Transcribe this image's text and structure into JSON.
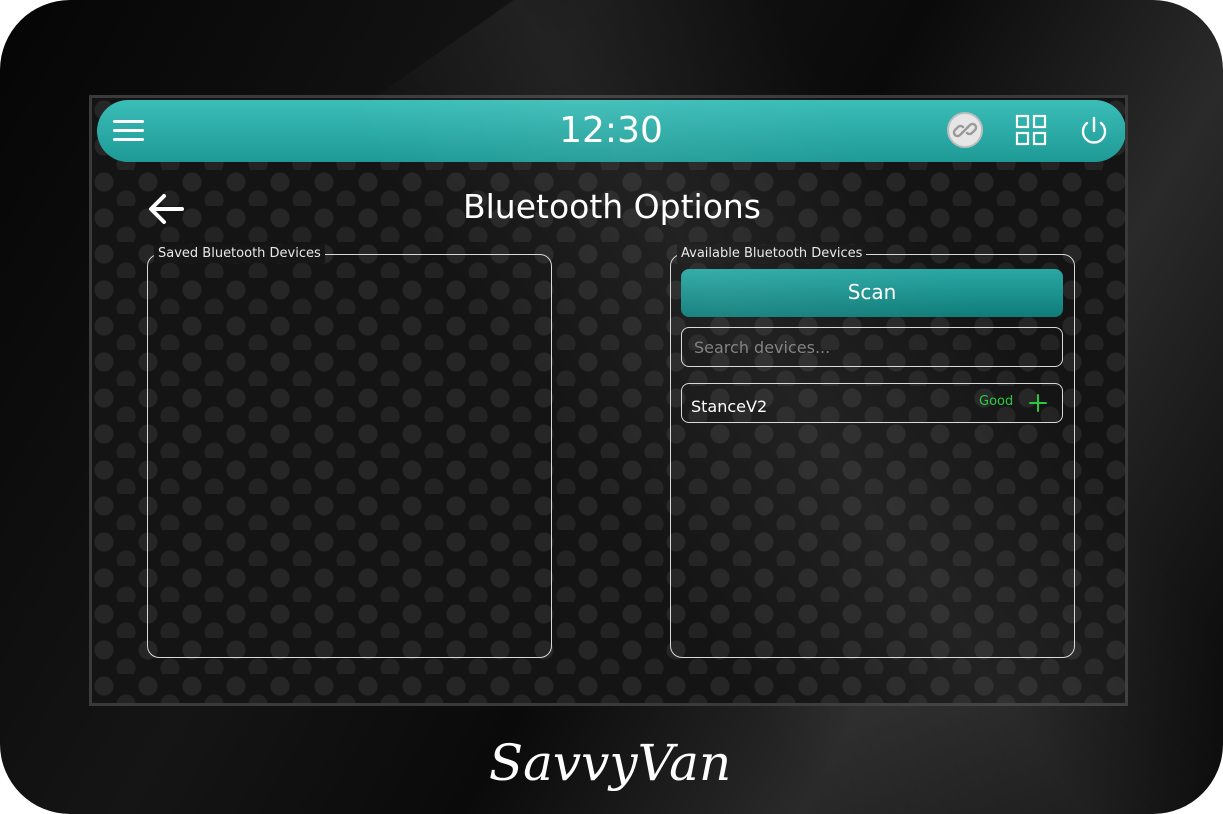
{
  "header": {
    "time": "12:30",
    "menu_icon": "hamburger-menu-icon",
    "link_icon": "link-icon",
    "grid_icon": "grid-icon",
    "power_icon": "power-icon",
    "accent_color": "#2bb0ac"
  },
  "page": {
    "title": "Bluetooth Options",
    "back_icon": "back-arrow-icon"
  },
  "saved_panel": {
    "legend": "Saved Bluetooth Devices",
    "devices": []
  },
  "available_panel": {
    "legend": "Available Bluetooth Devices",
    "scan_label": "Scan",
    "search_placeholder": "Search devices...",
    "search_value": "",
    "devices": [
      {
        "name": "StanceV2",
        "signal": "Good",
        "signal_color": "#27c93f",
        "action_icon": "plus-icon"
      }
    ]
  },
  "brand": {
    "logo_text": "SavvyVan"
  }
}
